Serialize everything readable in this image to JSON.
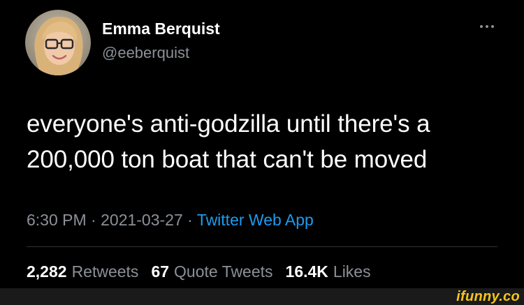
{
  "tweet": {
    "author": {
      "name": "Emma Berquist",
      "handle": "@eeberquist"
    },
    "text_lines": [
      "everyone's anti-godzilla until there's a",
      "200,000 ton boat that can't be moved"
    ],
    "time": "6:30 PM",
    "separator": " · ",
    "date": "2021-03-27",
    "source": "Twitter Web App",
    "stats": {
      "retweets": {
        "count": "2,282",
        "label": "Retweets"
      },
      "quote_tweets": {
        "count": "67",
        "label": "Quote Tweets"
      },
      "likes": {
        "count": "16.4K",
        "label": "Likes"
      }
    }
  },
  "watermark": "ifunny.co",
  "colors": {
    "background": "#000000",
    "text": "#ffffff",
    "muted": "#8b9197",
    "link": "#1d9bf0",
    "watermark": "#f5c518"
  },
  "icons": {
    "more": "more-dots-icon"
  }
}
